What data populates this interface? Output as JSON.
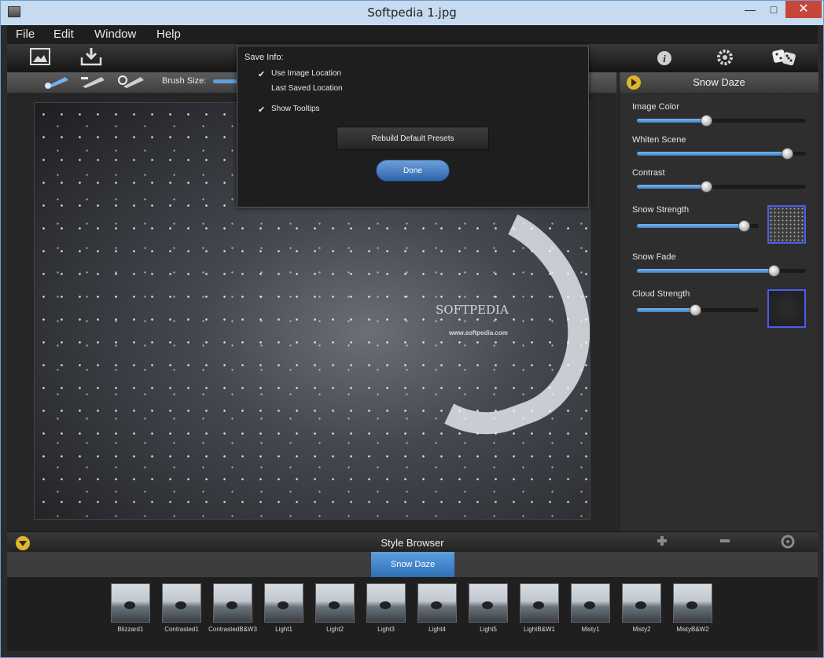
{
  "window": {
    "title": "Softpedia 1.jpg",
    "controls": {
      "minimize": "—",
      "maximize": "□",
      "close": "✕"
    }
  },
  "menu": {
    "file": "File",
    "edit": "Edit",
    "window": "Window",
    "help": "Help"
  },
  "brushbar": {
    "label": "Brush Size:"
  },
  "watermark": {
    "logo": "SOFTPEDIA",
    "url": "www.softpedia.com"
  },
  "dialog": {
    "heading": "Save Info:",
    "options": [
      {
        "label": "Use Image Location",
        "checked": true
      },
      {
        "label": "Last Saved Location",
        "checked": false
      },
      {
        "label": "Show Tooltips",
        "checked": true
      }
    ],
    "rebuild_label": "Rebuild Default Presets",
    "done_label": "Done"
  },
  "panel": {
    "title": "Snow Daze",
    "sliders": [
      {
        "label": "Image Color",
        "value": 0.41
      },
      {
        "label": "Whiten Scene",
        "value": 0.89
      },
      {
        "label": "Contrast",
        "value": 0.41
      },
      {
        "label": "Snow Strength",
        "value": 0.88
      },
      {
        "label": "Snow Fade",
        "value": 0.81
      },
      {
        "label": "Cloud Strength",
        "value": 0.48
      }
    ]
  },
  "style_browser": {
    "title": "Style Browser",
    "active_tab": "Snow Daze",
    "presets": [
      "Blizzard1",
      "Contrasted1",
      "ContrastedB&W3",
      "Light1",
      "Light2",
      "Light3",
      "Light4",
      "Light5",
      "LightB&W1",
      "Misty1",
      "Misty2",
      "MistyB&W2"
    ]
  },
  "colors": {
    "accent": "#4a8fd6",
    "play_icon": "#e0b628",
    "swatch_border": "#4b5cf0"
  }
}
